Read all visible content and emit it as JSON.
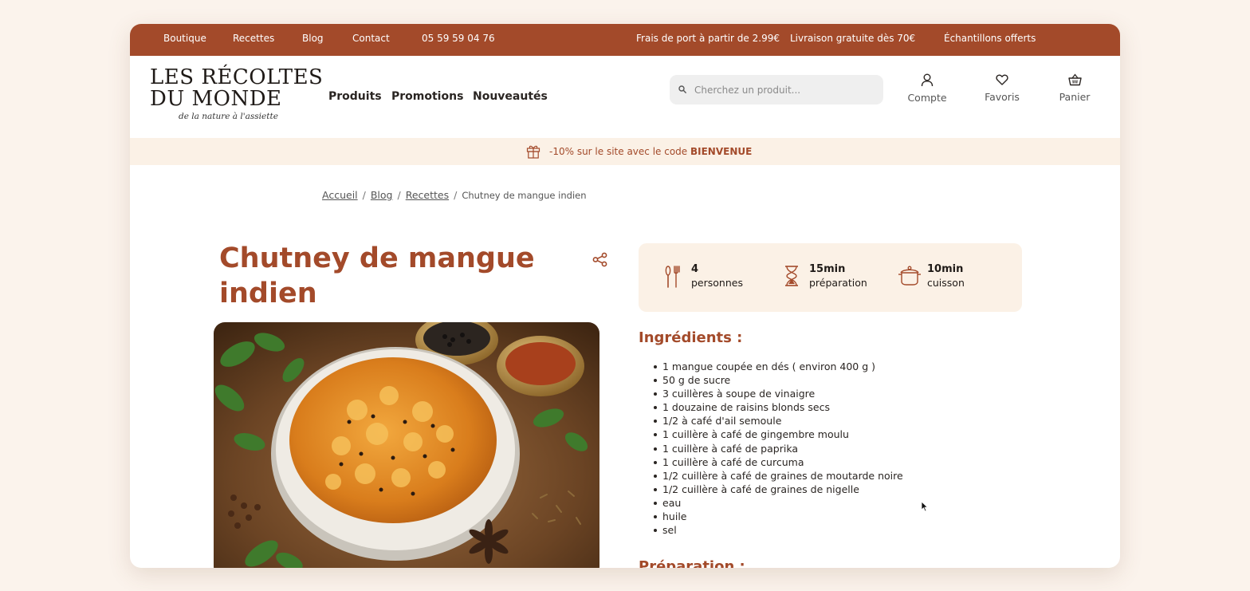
{
  "topbar": {
    "links": [
      "Boutique",
      "Recettes",
      "Blog",
      "Contact"
    ],
    "phone": "05 59 59 04 76",
    "shipping": "Frais de port à partir de 2.99€",
    "free_delivery": "Livraison gratuite dès 70€",
    "samples": "Échantillons offerts"
  },
  "logo": {
    "line1": "LES RÉCOLTES",
    "line2": "DU MONDE",
    "tagline": "de la nature à l'assiette"
  },
  "nav": [
    "Produits",
    "Promotions",
    "Nouveautés"
  ],
  "search": {
    "placeholder": "Cherchez un produit..."
  },
  "header_actions": {
    "account": "Compte",
    "favorites": "Favoris",
    "cart": "Panier"
  },
  "promo": {
    "text": "-10% sur le site avec le code ",
    "code": "BIENVENUE"
  },
  "breadcrumb": {
    "home": "Accueil",
    "blog": "Blog",
    "recipes": "Recettes",
    "current": "Chutney de mangue indien"
  },
  "recipe": {
    "title": "Chutney de mangue indien",
    "servings": {
      "value": "4",
      "label": "personnes"
    },
    "prep": {
      "value": "15min",
      "label": "préparation"
    },
    "cook": {
      "value": "10min",
      "label": "cuisson"
    },
    "ingredients_heading": "Ingrédients :",
    "ingredients": [
      "1 mangue coupée en dés ( environ 400 g )",
      "50 g de sucre",
      "3 cuillères à soupe de vinaigre",
      "1 douzaine de raisins blonds secs",
      "1/2 à café d'ail semoule",
      "1 cuillère à café de gingembre moulu",
      "1 cuillère à café de paprika",
      "1 cuillère à café de curcuma",
      "1/2 cuillère à café de graines de moutarde noire",
      "1/2 cuillère à café de graines de nigelle",
      "eau",
      "huile",
      "sel"
    ],
    "preparation_heading": "Préparation :"
  },
  "colors": {
    "brand": "#a34a2a",
    "cream": "#fbf1e6",
    "page_bg": "#fbf3ec"
  },
  "icons": [
    "search-icon",
    "user-icon",
    "heart-icon",
    "basket-icon",
    "gift-icon",
    "share-icon",
    "cutlery-icon",
    "hourglass-icon",
    "pot-icon",
    "mouse-cursor-icon"
  ]
}
